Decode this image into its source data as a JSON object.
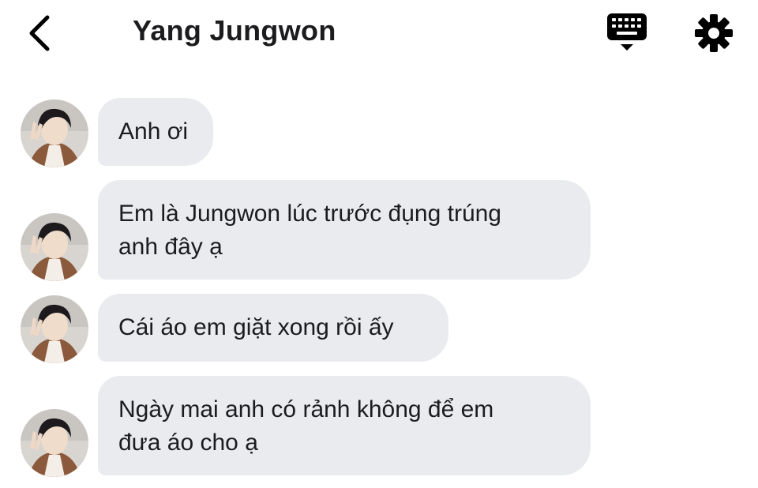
{
  "header": {
    "title": "Yang Jungwon",
    "back_icon": "chevron-left-icon",
    "keyboard_icon": "keyboard-icon",
    "settings_icon": "gear-icon"
  },
  "messages": [
    {
      "sender": "Yang Jungwon",
      "lines": [
        "Anh ơi"
      ]
    },
    {
      "sender": "Yang Jungwon",
      "lines": [
        "Em là Jungwon lúc trước đụng trúng",
        "anh đây ạ"
      ]
    },
    {
      "sender": "Yang Jungwon",
      "lines": [
        "Cái áo em giặt xong rồi ấy"
      ]
    },
    {
      "sender": "Yang Jungwon",
      "lines": [
        "Ngày mai anh có rảnh không để em",
        "đưa áo cho ạ"
      ]
    }
  ],
  "colors": {
    "bubble_background": "#e9ebef",
    "text": "#1c1c1e",
    "icon": "#000000"
  }
}
